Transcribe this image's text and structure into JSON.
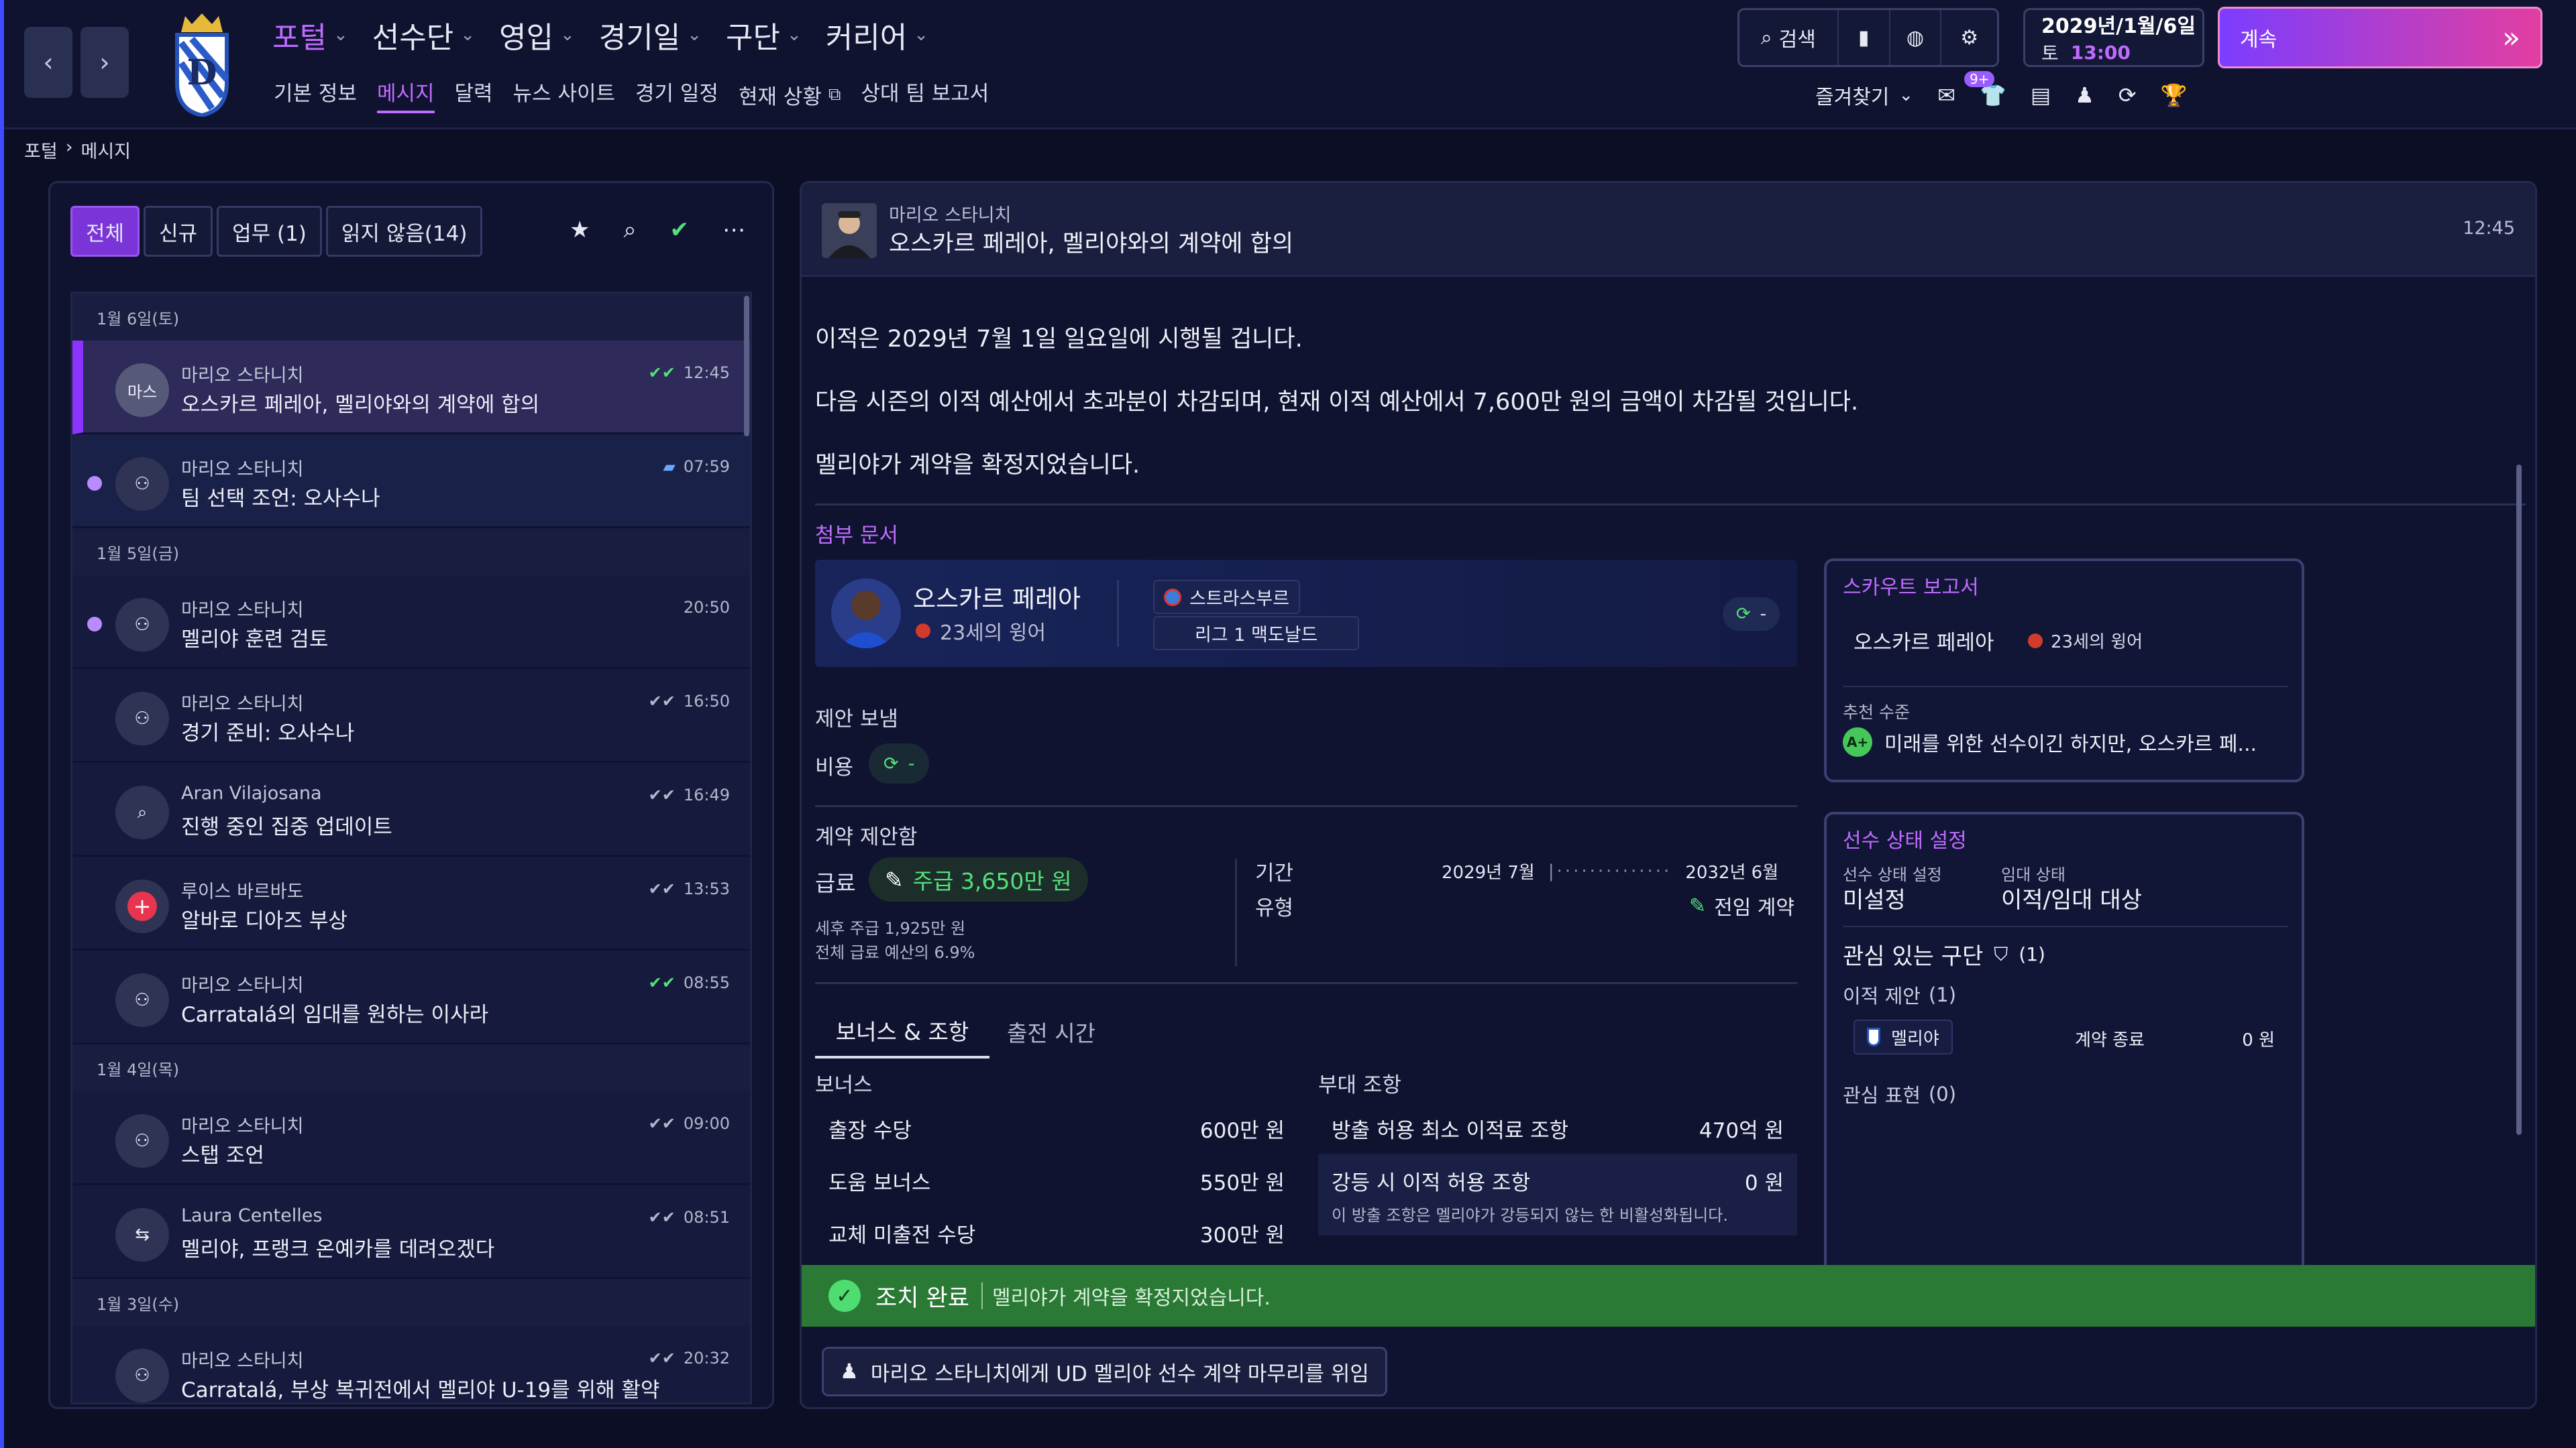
{
  "topbar": {
    "menu": [
      {
        "label": "포털",
        "active": true
      },
      {
        "label": "선수단",
        "active": false
      },
      {
        "label": "영입",
        "active": false
      },
      {
        "label": "경기일",
        "active": false
      },
      {
        "label": "구단",
        "active": false
      },
      {
        "label": "커리어",
        "active": false
      }
    ],
    "submenu": [
      {
        "label": "기본 정보",
        "active": false
      },
      {
        "label": "메시지",
        "active": true
      },
      {
        "label": "달력",
        "active": false
      },
      {
        "label": "뉴스 사이트",
        "active": false
      },
      {
        "label": "경기 일정",
        "active": false
      },
      {
        "label": "현재 상황",
        "active": false
      },
      {
        "label": "상대 팀 보고서",
        "active": false
      }
    ],
    "search_label": "검색",
    "date": "2029년/1월/6일",
    "weekday": "토",
    "time": "13:00",
    "continue_label": "계속",
    "favorites_label": "즐겨찾기",
    "notif_badge": "9+",
    "accent": "#c06bff",
    "continue_colors": [
      "#7b3dff",
      "#e23ea0"
    ]
  },
  "breadcrumb": {
    "root": "포털",
    "current": "메시지"
  },
  "inbox": {
    "filters": [
      {
        "label": "전체",
        "active": true
      },
      {
        "label": "신규",
        "active": false
      },
      {
        "label": "업무 (1)",
        "active": false
      },
      {
        "label": "읽지 않음(14)",
        "active": false
      }
    ],
    "groups": [
      {
        "date": "1월 6일(토)",
        "messages": [
          {
            "sender": "마리오 스타니치",
            "subject": "오스카르 페레아, 멜리야와의 계약에 합의",
            "time": "12:45",
            "avatar": "마스",
            "status": "read-green",
            "selected": true,
            "unread": false,
            "icon": "avatar-initials"
          },
          {
            "sender": "마리오 스타니치",
            "subject": "팀 선택 조언: 오사수나",
            "time": "07:59",
            "status": "chat",
            "selected": false,
            "unread": true,
            "icon": "staff-group-icon"
          }
        ]
      },
      {
        "date": "1월 5일(금)",
        "messages": [
          {
            "sender": "마리오 스타니치",
            "subject": "멜리야 훈련 검토",
            "time": "20:50",
            "status": "none",
            "selected": false,
            "unread": true,
            "icon": "staff-group-icon"
          },
          {
            "sender": "마리오 스타니치",
            "subject": "경기 준비: 오사수나",
            "time": "16:50",
            "status": "read",
            "selected": false,
            "unread": false,
            "icon": "staff-group-icon"
          },
          {
            "sender": "Aran Vilajosana",
            "subject": "진행 중인 집중 업데이트",
            "time": "16:49",
            "status": "read",
            "selected": false,
            "unread": false,
            "icon": "search-icon"
          },
          {
            "sender": "루이스 바르바도",
            "subject": "알바로 디아즈 부상",
            "time": "13:53",
            "status": "read",
            "selected": false,
            "unread": false,
            "icon": "medical-cross-icon"
          },
          {
            "sender": "마리오 스타니치",
            "subject": "Carratalá의 임대를 원하는 이사라",
            "time": "08:55",
            "status": "read-green",
            "selected": false,
            "unread": false,
            "icon": "staff-group-icon"
          }
        ]
      },
      {
        "date": "1월 4일(목)",
        "messages": [
          {
            "sender": "마리오 스타니치",
            "subject": "스탭 조언",
            "time": "09:00",
            "status": "read",
            "selected": false,
            "unread": false,
            "icon": "staff-group-icon"
          },
          {
            "sender": "Laura Centelles",
            "subject": "멜리야, 프랭크 온예카를 데려오겠다",
            "time": "08:51",
            "status": "read",
            "selected": false,
            "unread": false,
            "icon": "transfer-icon"
          }
        ]
      },
      {
        "date": "1월 3일(수)",
        "messages": [
          {
            "sender": "마리오 스타니치",
            "subject": "Carratalá, 부상 복귀전에서 멜리야 U-19를 위해 활약",
            "time": "20:32",
            "status": "read",
            "selected": false,
            "unread": false,
            "icon": "staff-group-icon"
          }
        ]
      }
    ]
  },
  "message": {
    "sender": "마리오 스타니치",
    "title": "오스카르 페레아, 멜리야와의 계약에 합의",
    "time": "12:45",
    "paragraphs": [
      "이적은 2029년 7월 1일 일요일에 시행될 겁니다.",
      "다음 시즌의 이적 예산에서 초과분이 차감되며, 현재 이적 예산에서 7,600만 원의 금액이 차감될 것입니다.",
      "멜리야가 계약을 확정지었습니다."
    ],
    "attachment_label": "첨부 문서",
    "player": {
      "name": "오스카르 페레아",
      "desc": "23세의 윙어",
      "club": "스트라스부르",
      "league": "리그 1 맥도날드",
      "status_value": "-"
    },
    "offer": {
      "sent_label": "제안 보냄",
      "cost_label": "비용",
      "cost_value": "-"
    },
    "contract": {
      "section_label": "계약 제안함",
      "wage_label": "급료",
      "wage_value": "주급 3,650만 원",
      "wage_after_tax": "세후 주급 1,925만 원",
      "wage_budget_share": "전체 급료 예산의 6.9%",
      "term_label": "기간",
      "term_start": "2029년 7월",
      "term_end": "2032년 6월",
      "type_label": "유형",
      "type_value": "전임 계약"
    },
    "tabs": [
      {
        "label": "보너스 & 조항",
        "active": true
      },
      {
        "label": "출전 시간",
        "active": false
      }
    ],
    "bonuses": {
      "title": "보너스",
      "rows": [
        {
          "label": "출장 수당",
          "value": "600만 원"
        },
        {
          "label": "도움 보너스",
          "value": "550만 원"
        },
        {
          "label": "교체 미출전 수당",
          "value": "300만 원"
        }
      ]
    },
    "clauses": {
      "title": "부대 조항",
      "rows": [
        {
          "label": "방출 허용 최소 이적료 조항",
          "value": "470억 원"
        },
        {
          "label": "강등 시 이적 허용 조항",
          "value": "0 원"
        }
      ],
      "note": "이 방출 조항은 멜리야가 강등되지 않는 한 비활성화됩니다."
    },
    "scout": {
      "title": "스카우트 보고서",
      "player_name": "오스카르 페레아",
      "player_desc": "23세의 윙어",
      "rec_label": "추천 수준",
      "rec_grade": "A+",
      "rec_text": "미래를 위한 선수이긴 하지만, 오스카르 페..."
    },
    "status_box": {
      "title": "선수 상태 설정",
      "status_label": "선수 상태 설정",
      "status_value": "미설정",
      "loan_label": "임대 상태",
      "loan_value": "이적/임대 대상",
      "interested_label": "관심 있는 구단",
      "interested_count": "(1)",
      "offers_label": "이적 제안",
      "offers_count": "(1)",
      "offer_club": "멜리야",
      "offer_status": "계약 종료",
      "offer_amount": "0 원",
      "interest_label": "관심 표현",
      "interest_count": "(0)"
    },
    "banner": {
      "title": "조치 완료",
      "text": "멜리야가 계약을 확정지었습니다.",
      "color": "#2a7a35"
    },
    "delegate_label": "마리오 스타니치에게 UD 멜리야 선수 계약 마무리를 위임"
  }
}
